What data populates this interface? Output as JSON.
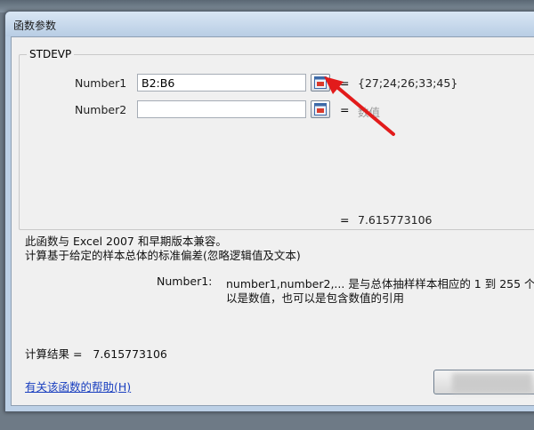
{
  "dialog": {
    "title": "函数参数",
    "function_name": "STDEVP"
  },
  "arguments": [
    {
      "label": "Number1",
      "value": "B2:B6",
      "equals": "=",
      "preview": "{27;24;26;33;45}"
    },
    {
      "label": "Number2",
      "value": "",
      "equals": "=",
      "preview": "数值"
    }
  ],
  "formula_result_line": {
    "equals": "=",
    "value": "7.615773106"
  },
  "description": {
    "line1": "此函数与 Excel 2007 和早期版本兼容。",
    "line2": "计算基于给定的样本总体的标准偏差(忽略逻辑值及文本)"
  },
  "arg_help": {
    "name": "Number1:",
    "line1": "number1,number2,... 是与总体抽样样本相应的 1 到 255 个",
    "line2": "以是数值，也可以是包含数值的引用"
  },
  "calc_result": "计算结果 =   7.615773106",
  "help_link": "有关该函数的帮助(H)",
  "colors": {
    "annotation_arrow": "#e21b1b",
    "link": "#1a3fbf"
  },
  "icons": {
    "collapse_button": "range-select-icon",
    "annotation": "red-arrow-annotation"
  }
}
